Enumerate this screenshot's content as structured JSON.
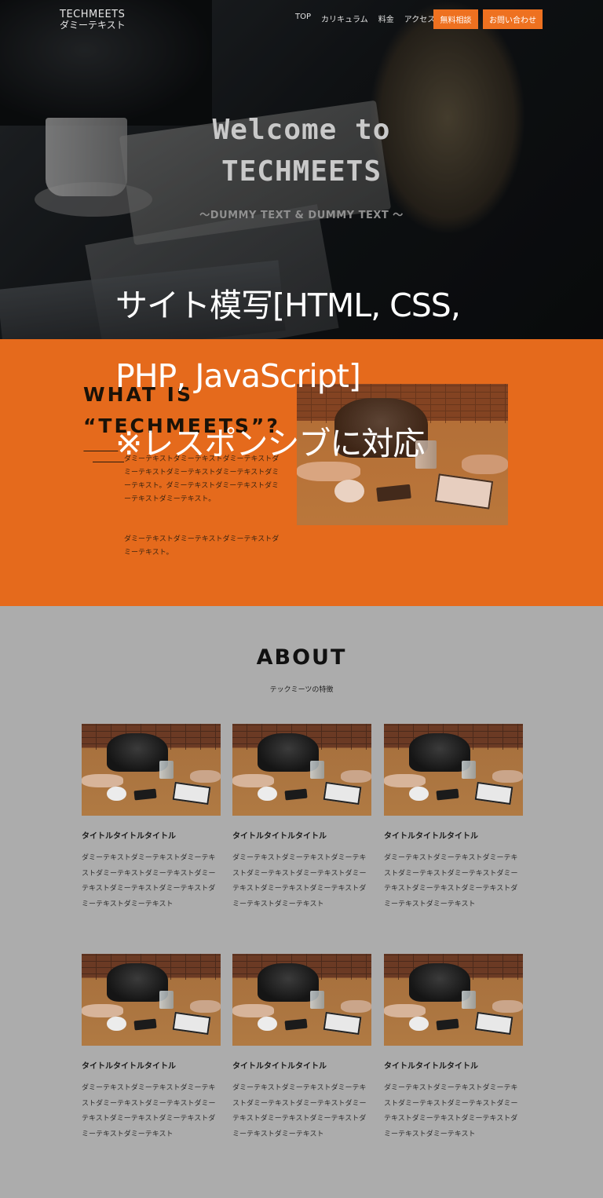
{
  "header": {
    "logo_line1": "TECHMEETS",
    "logo_line2": "ダミーテキスト",
    "nav": [
      "TOP",
      "カリキュラム",
      "料金",
      "アクセス"
    ],
    "btn_consult": "無料相談",
    "btn_contact": "お問い合わせ"
  },
  "hero": {
    "title_line1": "Welcome to",
    "title_line2": "TECHMEETS",
    "subtitle": "〜DUMMY TEXT & DUMMY TEXT 〜"
  },
  "caption": {
    "line1": "サイト模写[HTML, CSS,",
    "line2": "PHP, JavaScript]",
    "line3": "※レスポンシブに対応"
  },
  "what": {
    "title_line1": "WHAT IS",
    "title_line2": "“TECHMEETS”?",
    "paragraph1": "ダミーテキストダミーテキストダミーテキストダミーテキストダミーテキストダミーテキストダミーテキスト。ダミーテキストダミーテキストダミーテキストダミーテキスト。",
    "paragraph2": "ダミーテキストダミーテキストダミーテキストダミーテキスト。"
  },
  "about": {
    "title": "ABOUT",
    "subtitle": "テックミーツの特徴",
    "cards": [
      {
        "title": "タイトルタイトルタイトル",
        "text": "ダミーテキストダミーテキストダミーテキストダミーテキストダミーテキストダミーテキストダミーテキストダミーテキストダミーテキストダミーテキスト"
      },
      {
        "title": "タイトルタイトルタイトル",
        "text": "ダミーテキストダミーテキストダミーテキストダミーテキストダミーテキストダミーテキストダミーテキストダミーテキストダミーテキストダミーテキスト"
      },
      {
        "title": "タイトルタイトルタイトル",
        "text": "ダミーテキストダミーテキストダミーテキストダミーテキストダミーテキストダミーテキストダミーテキストダミーテキストダミーテキストダミーテキスト"
      },
      {
        "title": "タイトルタイトルタイトル",
        "text": "ダミーテキストダミーテキストダミーテキストダミーテキストダミーテキストダミーテキストダミーテキストダミーテキストダミーテキストダミーテキスト"
      },
      {
        "title": "タイトルタイトルタイトル",
        "text": "ダミーテキストダミーテキストダミーテキストダミーテキストダミーテキストダミーテキストダミーテキストダミーテキストダミーテキストダミーテキスト"
      },
      {
        "title": "タイトルタイトルタイトル",
        "text": "ダミーテキストダミーテキストダミーテキストダミーテキストダミーテキストダミーテキストダミーテキストダミーテキストダミーテキストダミーテキスト"
      }
    ]
  },
  "colors": {
    "accent_orange": "#ee7120",
    "section_orange": "#e56a1c",
    "page_gray": "#acacac"
  }
}
